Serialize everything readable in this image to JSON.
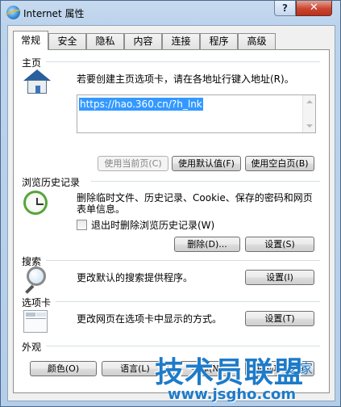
{
  "window": {
    "title": "Internet 属性",
    "help_label": "?",
    "close_label": "✕"
  },
  "tabs": [
    {
      "label": "常规",
      "active": true
    },
    {
      "label": "安全"
    },
    {
      "label": "隐私"
    },
    {
      "label": "内容"
    },
    {
      "label": "连接"
    },
    {
      "label": "程序"
    },
    {
      "label": "高级"
    }
  ],
  "home_page": {
    "group_title": "主页",
    "description": "若要创建主页选项卡，请在各地址行键入地址(R)。",
    "url_value": "https://hao.360.cn/?h_lnk",
    "use_current_button": "使用当前页(C)",
    "use_default_button": "使用默认值(F)",
    "use_blank_button": "使用空白页(B)"
  },
  "history": {
    "group_title": "浏览历史记录",
    "description_line1": "删除临时文件、历史记录、Cookie、保存的密码和网页",
    "description_line2": "表单信息。",
    "checkbox_label": "退出时删除浏览历史记录(W)",
    "checkbox_checked": false,
    "delete_button": "删除(D)...",
    "settings_button": "设置(S)"
  },
  "search": {
    "group_title": "搜索",
    "description": "更改默认的搜索提供程序。",
    "settings_button": "设置(I)"
  },
  "tabs_section": {
    "group_title": "选项卡",
    "description": "更改网页在选项卡中显示的方式。",
    "settings_button": "设置(T)"
  },
  "appearance": {
    "group_title": "外观",
    "colors_button": "颜色(O)",
    "languages_button": "语言(L)",
    "fonts_button": "字体(N)",
    "accessibility_button": "辅助功能(E)"
  },
  "watermark": {
    "main": "技术员联盟",
    "url": "www.jsgho.com",
    "tag": "之家"
  },
  "colors": {
    "selection": "#3399ff",
    "watermark": "#1e7bc9",
    "close_button": "#c9452f"
  }
}
